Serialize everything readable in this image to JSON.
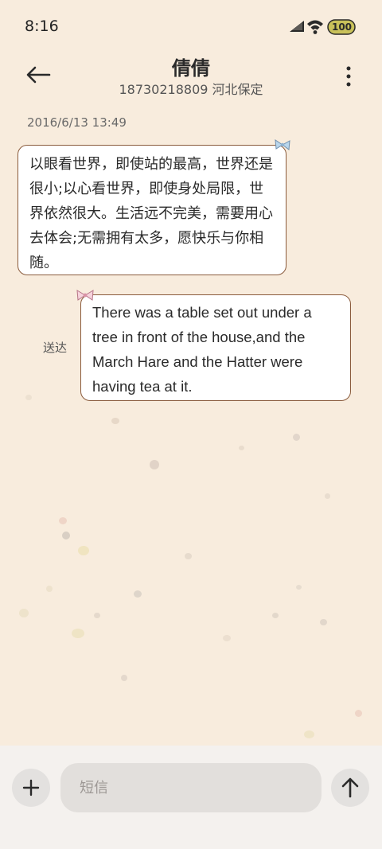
{
  "status_bar": {
    "time": "8:16",
    "battery": "100"
  },
  "header": {
    "contact_name": "倩倩",
    "contact_subtitle": "18730218809 河北保定"
  },
  "conversation": {
    "timestamp": "2016/6/13 13:49",
    "messages": [
      {
        "direction": "incoming",
        "text": "以眼看世界，即使站的最高，世界还是很小;以心看世界，即使身处局限，世界依然很大。生活远不完美，需要用心去体会;无需拥有太多，愿快乐与你相随。"
      },
      {
        "direction": "outgoing",
        "text": "There was a table set out under a tree in front of the house,and the March Hare and the Hatter were having tea at it.",
        "status": "送达"
      }
    ]
  },
  "composer": {
    "placeholder": "短信"
  },
  "colors": {
    "background": "#f8ecdd",
    "bubble_border": "#8a5b3c",
    "bubble_fill": "#ffffff",
    "input_bar": "#f4f1ee"
  },
  "icons": {
    "back": "arrow-left-icon",
    "more": "more-vertical-icon",
    "add": "plus-icon",
    "send": "arrow-up-icon"
  }
}
